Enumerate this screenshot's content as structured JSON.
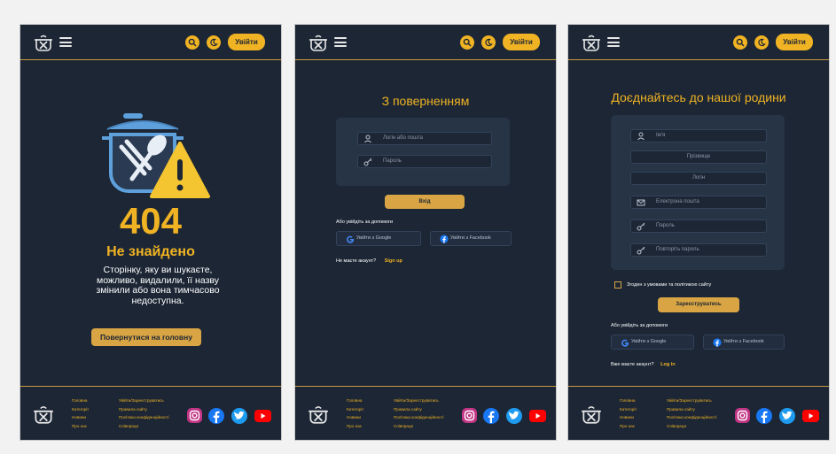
{
  "header": {
    "login_label": "Увійти"
  },
  "icons": {
    "search": "search-icon",
    "theme": "moon-icon",
    "menu": "hamburger-menu-icon",
    "logo": "pot-utensils-logo"
  },
  "error_page": {
    "code": "404",
    "title": "Не знайдено",
    "desc_lines": [
      "Сторінку, яку ви шукаєте,",
      "можливо, видалили, її назву",
      "змінили або вона тимчасово",
      "недоступна."
    ],
    "home_button": "Повернутися на головну"
  },
  "login_page": {
    "title": "З поверненням",
    "login_placeholder": "Логін або пошта",
    "password_placeholder": "Пароль",
    "submit_label": "Вхід",
    "or_label": "Або увійдіть за допомоги",
    "google_label": "Увійти з Google",
    "facebook_label": "Увійти з Facebook",
    "no_account_text": "Не маєте акаунт?",
    "signup_link": "Sign up"
  },
  "register_page": {
    "title": "Доєднайтесь до нашої родини",
    "name_placeholder": "Ім'я",
    "surname_placeholder": "Прізвище",
    "login_placeholder": "Логін",
    "email_placeholder": "Електрона пошта",
    "password_placeholder": "Пароль",
    "password_repeat_placeholder": "Повторіть пароль",
    "terms_label": "Згоден з умовами та політикою сайту",
    "submit_label": "Зареєструватись",
    "or_label": "Або увійдіть за допомоги",
    "google_label": "Увійти з Google",
    "facebook_label": "Увійти з Facebook",
    "have_account_text": "Вже маєте акаунт?",
    "login_link": "Log in"
  },
  "footer": {
    "col1": [
      "Головна",
      "Категорії",
      "Новини",
      "Про нас"
    ],
    "col2": [
      "Увійти/Зареєструватись",
      "Правила сайту",
      "Політика конфіденційності",
      "Співпраця"
    ],
    "social": [
      "instagram-icon",
      "facebook-icon",
      "twitter-icon",
      "youtube-icon"
    ]
  },
  "colors": {
    "bg": "#1c2635",
    "accent": "#f0b323",
    "button": "#d9a544",
    "box": "#263446"
  }
}
